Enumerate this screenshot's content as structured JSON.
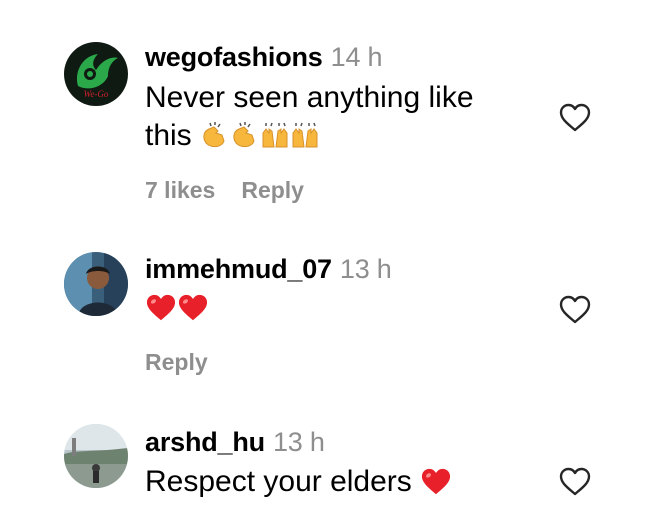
{
  "comments": [
    {
      "username": "wegofashions",
      "time": "14 h",
      "text_line1": "Never seen anything like",
      "text_line2": "this",
      "likes": "7 likes",
      "reply": "Reply",
      "avatar_text": "We-Go",
      "emojis": [
        "clapping-hands",
        "clapping-hands",
        "raising-hands",
        "raising-hands"
      ]
    },
    {
      "username": "immehmud_07",
      "time": "13 h",
      "text": "",
      "reply": "Reply",
      "emojis": [
        "red-heart",
        "red-heart"
      ]
    },
    {
      "username": "arshd_hu",
      "time": "13 h",
      "text": "Respect your elders",
      "emojis": [
        "red-heart"
      ]
    }
  ],
  "colors": {
    "secondary_text": "#8e8e8e",
    "heart_red": "#e8202a",
    "brand_green": "#2aa84a"
  }
}
